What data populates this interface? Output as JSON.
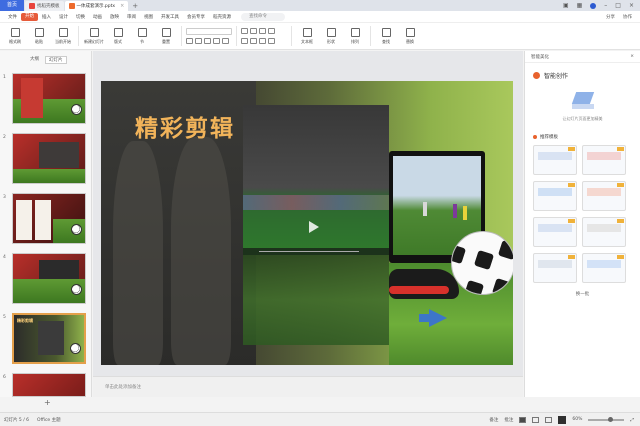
{
  "titlebar": {
    "home_label": "首页",
    "tabs": [
      {
        "label": "找稻壳模板"
      },
      {
        "label": "一体成套演示.pptx"
      }
    ],
    "add_label": "+"
  },
  "menubar": {
    "items": [
      "文件",
      "开始",
      "插入",
      "设计",
      "切换",
      "动画",
      "放映",
      "审阅",
      "视图",
      "开发工具",
      "会员专享",
      "稻壳资源"
    ],
    "active_index": 1,
    "search_placeholder": "查找命令",
    "right_items": [
      "分享",
      "协作"
    ]
  },
  "ribbon": {
    "buttons": [
      {
        "label": "格式刷"
      },
      {
        "label": "粘贴"
      },
      {
        "label": "当前开始"
      },
      {
        "label": "新建幻灯片"
      },
      {
        "label": "版式"
      },
      {
        "label": "节"
      },
      {
        "label": "重置"
      },
      {
        "label": "文本框"
      },
      {
        "label": "形状"
      },
      {
        "label": "排列"
      },
      {
        "label": "查找"
      },
      {
        "label": "替换"
      }
    ]
  },
  "leftpane": {
    "tabs": [
      "大纲",
      "幻灯片"
    ],
    "selected_tab": 1,
    "thumbnails": [
      {
        "num": "1",
        "title": ""
      },
      {
        "num": "2",
        "title": ""
      },
      {
        "num": "3",
        "title": ""
      },
      {
        "num": "4",
        "title": ""
      },
      {
        "num": "5",
        "title": "精彩剪辑"
      },
      {
        "num": "6",
        "title": ""
      }
    ],
    "selected_index": 4,
    "add_label": "+"
  },
  "slide": {
    "title": "精彩剪辑"
  },
  "notes_placeholder": "单击此处添加备注",
  "rightpane": {
    "header": "智能美化",
    "title": "智能创作",
    "desc": "让幻灯片页面更加精美",
    "section": "推荐模板",
    "cards": [
      {
        "label": ""
      },
      {
        "label": ""
      },
      {
        "label": ""
      },
      {
        "label": ""
      },
      {
        "label": ""
      },
      {
        "label": ""
      },
      {
        "label": ""
      },
      {
        "label": ""
      }
    ],
    "more": "换一批"
  },
  "statusbar": {
    "slide_pos": "幻灯片 5 / 6",
    "theme": "Office 主题",
    "notes": "备注",
    "comments": "批注",
    "zoom": "60%"
  },
  "colors": {
    "accent": "#e65b3a",
    "home_blue": "#3e6ce0",
    "slide_title": "#f2b45a"
  }
}
